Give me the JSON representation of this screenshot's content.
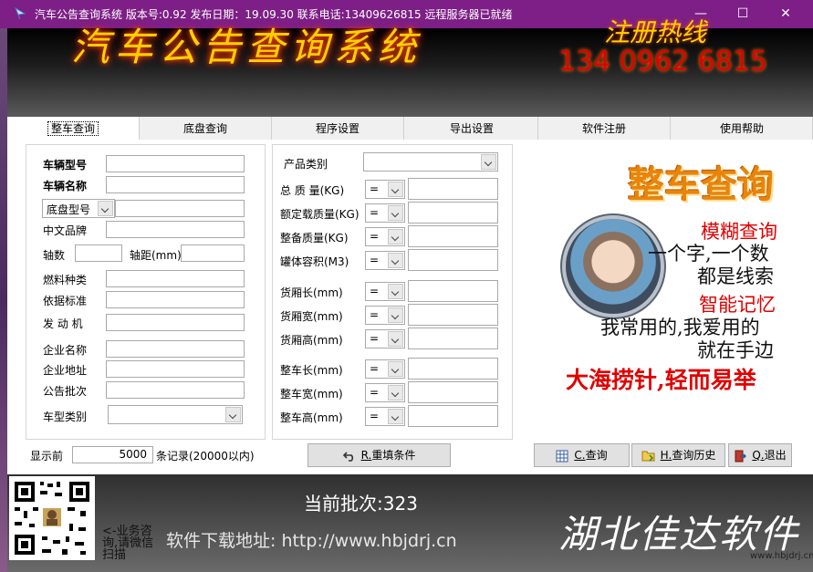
{
  "window": {
    "title": "汽车公告查询系统  版本号:0.92 发布日期：19.09.30  联系电话:13409626815  远程服务器已就绪",
    "minimize": "—",
    "maximize": "☐",
    "close": "✕"
  },
  "header": {
    "title": "汽车公告查询系统",
    "hotline_label": "注册热线",
    "hotline_number": "134 0962 6815"
  },
  "tabs": [
    "整车查询",
    "底盘查询",
    "程序设置",
    "导出设置",
    "软件注册",
    "使用帮助"
  ],
  "left_panel": {
    "vehicle_model": {
      "label": "车辆型号",
      "value": ""
    },
    "vehicle_name": {
      "label": "车辆名称",
      "value": ""
    },
    "chassis_select": {
      "selected": "底盘型号",
      "value": ""
    },
    "chinese_brand": {
      "label": "中文品牌",
      "value": ""
    },
    "axle_count": {
      "label": "轴数",
      "value": ""
    },
    "wheelbase": {
      "label": "轴距(mm)",
      "value": ""
    },
    "fuel_type": {
      "label": "燃料种类",
      "value": ""
    },
    "standard": {
      "label": "依据标准",
      "value": ""
    },
    "engine": {
      "label": "发 动 机",
      "value": ""
    },
    "company_name": {
      "label": "企业名称",
      "value": ""
    },
    "company_address": {
      "label": "企业地址",
      "value": ""
    },
    "batch": {
      "label": "公告批次",
      "value": ""
    },
    "vehicle_type": {
      "label": "车型类别",
      "selected": ""
    }
  },
  "right_panel": {
    "product_type": {
      "label": "产品类别",
      "selected": ""
    },
    "rows": [
      {
        "label": "总 质 量(KG)",
        "op": "=",
        "value": ""
      },
      {
        "label": "额定载质量(KG)",
        "op": "=",
        "value": ""
      },
      {
        "label": "整备质量(KG)",
        "op": "=",
        "value": ""
      },
      {
        "label": "罐体容积(M3)",
        "op": "=",
        "value": ""
      },
      {
        "label": "货厢长(mm)",
        "op": "=",
        "value": ""
      },
      {
        "label": "货厢宽(mm)",
        "op": "=",
        "value": ""
      },
      {
        "label": "货厢高(mm)",
        "op": "=",
        "value": ""
      },
      {
        "label": "整车长(mm)",
        "op": "=",
        "value": ""
      },
      {
        "label": "整车宽(mm)",
        "op": "=",
        "value": ""
      },
      {
        "label": "整车高(mm)",
        "op": "=",
        "value": ""
      }
    ]
  },
  "footer_controls": {
    "show_prefix": "显示前",
    "show_count": "5000",
    "show_suffix": "条记录(20000以内)",
    "reset_label": "重填条件",
    "reset_key": "R.",
    "query_label": "查询",
    "query_key": "C.",
    "history_label": "查询历史",
    "history_key": "H.",
    "exit_label": "退出",
    "exit_key": "Q."
  },
  "promo": {
    "title": "整车查询",
    "line1": "模糊查询",
    "line2": "一个字,一个数",
    "line3": "都是线索",
    "line4": "智能记忆",
    "line5": "我常用的,我爱用的",
    "line6": "就在手边",
    "line7": "大海捞针,轻而易举"
  },
  "bottom": {
    "current_batch": "当前批次:323",
    "follow_text": "<-业务咨询,请微信扫描",
    "download": "软件下载地址:  http://www.hbjdrj.cn",
    "brand": "湖北佳达软件",
    "watermark": "www.hbjdrj.cn"
  },
  "colors": {
    "titlebar": "#7d1f86",
    "header_gold": "#ffd100",
    "hotline_red": "#e00000",
    "promo_orange": "#e8840c",
    "promo_red": "#e00000"
  }
}
